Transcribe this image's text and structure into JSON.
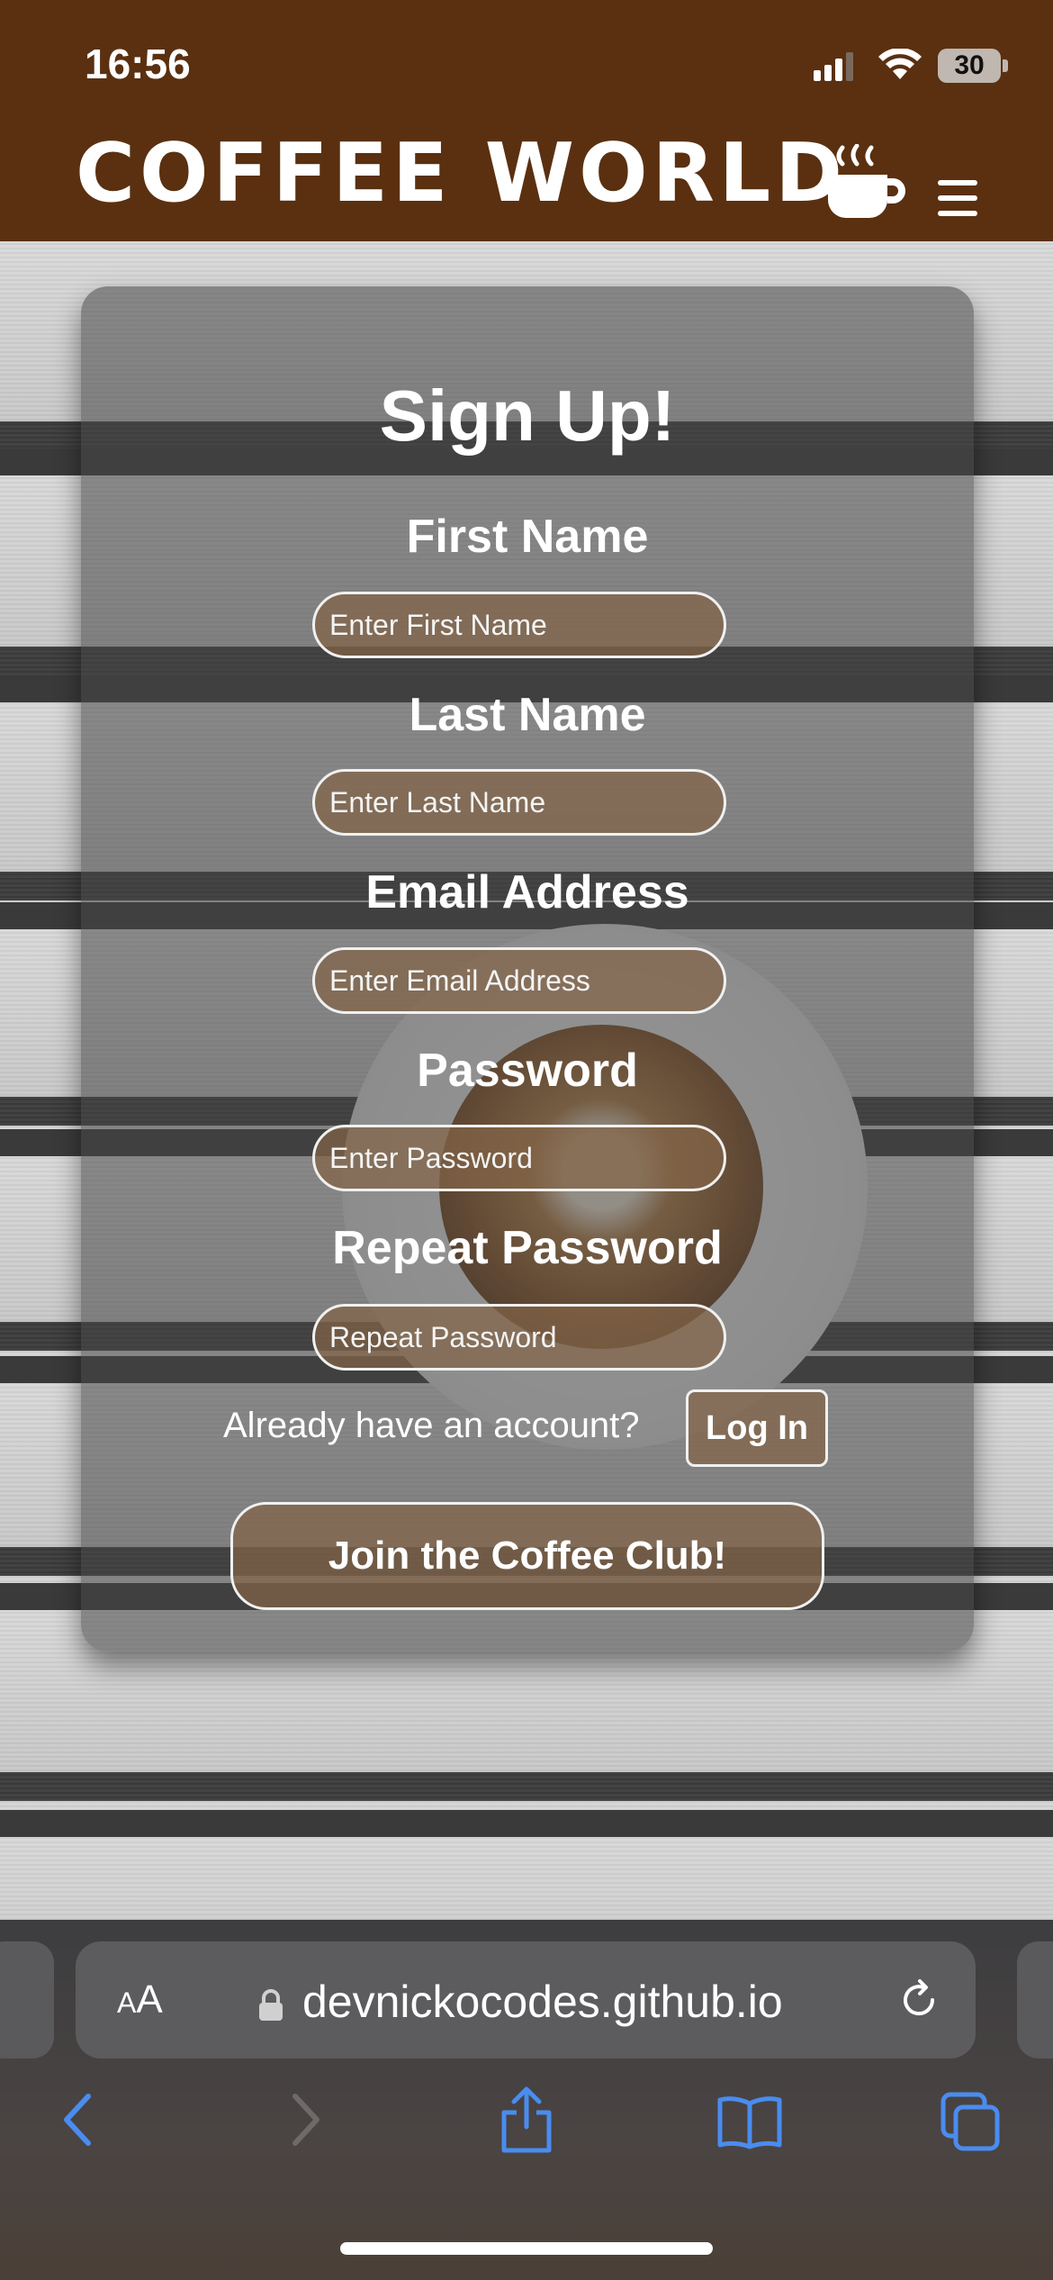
{
  "status": {
    "time": "16:56",
    "battery": "30"
  },
  "header": {
    "brand": "COFFEE WORLD",
    "cup_icon": "coffee-cup-icon",
    "menu_icon": "hamburger-icon"
  },
  "form": {
    "title": "Sign Up!",
    "fields": [
      {
        "label": "First Name",
        "placeholder": "Enter First Name",
        "value": ""
      },
      {
        "label": "Last Name",
        "placeholder": "Enter Last Name",
        "value": ""
      },
      {
        "label": "Email Address",
        "placeholder": "Enter Email Address",
        "value": ""
      },
      {
        "label": "Password",
        "placeholder": "Enter Password",
        "value": ""
      },
      {
        "label": "Repeat Password",
        "placeholder": "Repeat Password",
        "value": ""
      }
    ],
    "already_text": "Already have an account?",
    "login_label": "Log In",
    "submit_label": "Join the Coffee Club!"
  },
  "browser": {
    "aa_small": "A",
    "aa_large": "A",
    "url": "devnickocodes.github.io",
    "accent": "#4a8cf0"
  }
}
